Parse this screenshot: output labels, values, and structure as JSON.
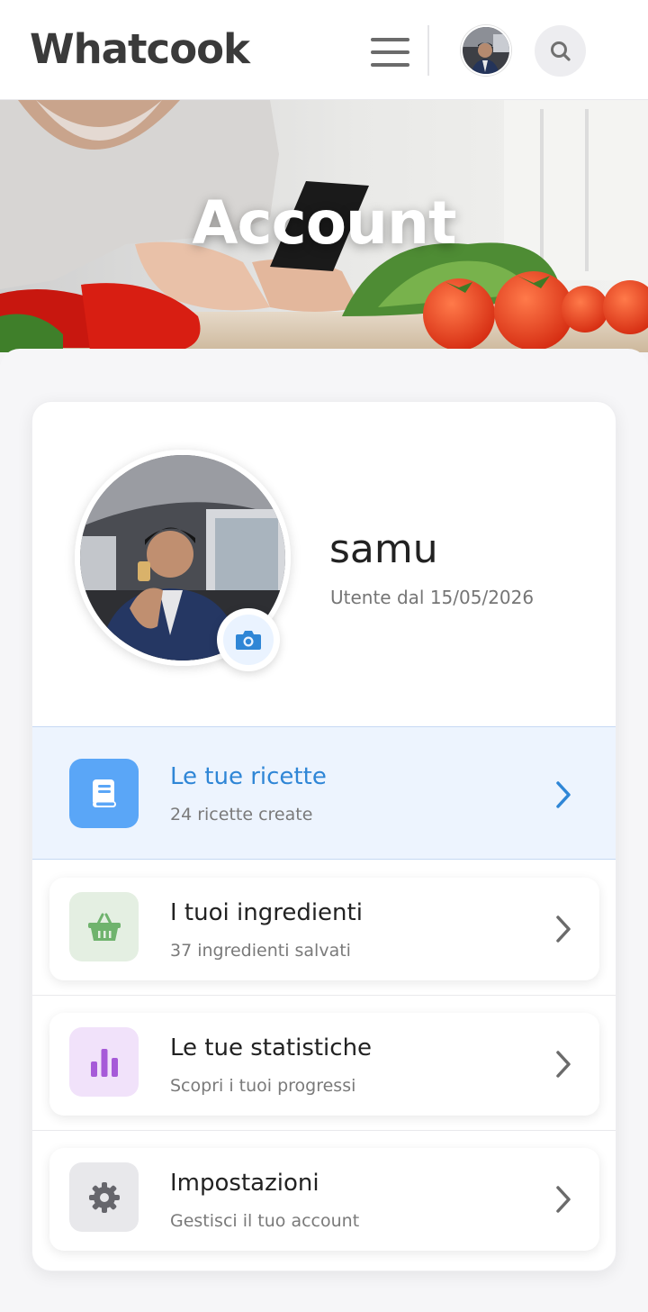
{
  "header": {
    "logo": "Whatcook",
    "menu_icon": "hamburger-menu-icon",
    "search_icon": "search-icon"
  },
  "hero": {
    "title": "Account"
  },
  "profile": {
    "username": "samu",
    "member_since": "Utente dal 15/05/2026",
    "camera_icon": "camera-icon"
  },
  "menu": {
    "items": [
      {
        "title": "Le tue ricette",
        "subtitle": "24 ricette create",
        "icon": "book-icon",
        "accent": "#5aa6f7",
        "active": true
      },
      {
        "title": "I tuoi ingredienti",
        "subtitle": "37 ingredienti salvati",
        "icon": "basket-icon",
        "accent": "#7dba7b",
        "active": false
      },
      {
        "title": "Le tue statistiche",
        "subtitle": "Scopri i tuoi progressi",
        "icon": "bar-chart-icon",
        "accent": "#a65ad8",
        "active": false
      },
      {
        "title": "Impostazioni",
        "subtitle": "Gestisci il tuo account",
        "icon": "gear-icon",
        "accent": "#6a6a70",
        "active": false
      }
    ]
  },
  "colors": {
    "active_text": "#2f86d6",
    "active_bg": "#edf4fe"
  }
}
